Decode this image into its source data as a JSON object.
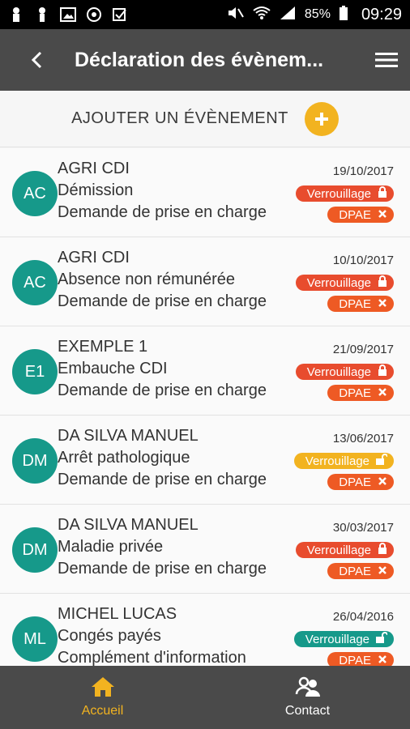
{
  "status_bar": {
    "battery": "85%",
    "time": "09:29"
  },
  "header": {
    "title": "Déclaration des évènem..."
  },
  "add_event": {
    "label": "AJOUTER UN ÉVÈNEMENT"
  },
  "colors": {
    "teal": "#16998a",
    "red": "#ee5a24",
    "orange_red": "#e84c2e",
    "yellow": "#f2b320",
    "dark_bar": "#4a4a4a"
  },
  "events": [
    {
      "initials": "AC",
      "name": "AGRI CDI",
      "type": "Démission",
      "detail": "Demande de prise en charge",
      "date": "19/10/2017",
      "lock_label": "Verrouillage",
      "lock_color": "#e84c2e",
      "lock_icon": "lock-closed-icon",
      "dpae_label": "DPAE"
    },
    {
      "initials": "AC",
      "name": "AGRI CDI",
      "type": "Absence non rémunérée",
      "detail": "Demande de prise en charge",
      "date": "10/10/2017",
      "lock_label": "Verrouillage",
      "lock_color": "#e84c2e",
      "lock_icon": "lock-closed-icon",
      "dpae_label": "DPAE"
    },
    {
      "initials": "E1",
      "name": "EXEMPLE 1",
      "type": "Embauche CDI",
      "detail": "Demande de prise en charge",
      "date": "21/09/2017",
      "lock_label": "Verrouillage",
      "lock_color": "#e84c2e",
      "lock_icon": "lock-closed-icon",
      "dpae_label": "DPAE"
    },
    {
      "initials": "DM",
      "name": "DA SILVA MANUEL",
      "type": "Arrêt pathologique",
      "detail": "Demande de prise en charge",
      "date": "13/06/2017",
      "lock_label": "Verrouillage",
      "lock_color": "#f2b320",
      "lock_icon": "lock-open-icon",
      "dpae_label": "DPAE"
    },
    {
      "initials": "DM",
      "name": "DA SILVA MANUEL",
      "type": "Maladie privée",
      "detail": "Demande de prise en charge",
      "date": "30/03/2017",
      "lock_label": "Verrouillage",
      "lock_color": "#e84c2e",
      "lock_icon": "lock-closed-icon",
      "dpae_label": "DPAE"
    },
    {
      "initials": "ML",
      "name": "MICHEL LUCAS",
      "type": "Congés payés",
      "detail": "Complément d'information",
      "date": "26/04/2016",
      "lock_label": "Verrouillage",
      "lock_color": "#16998a",
      "lock_icon": "lock-open-icon",
      "dpae_label": "DPAE"
    }
  ],
  "bottom_nav": [
    {
      "label": "Accueil",
      "icon": "home-icon",
      "color": "#f2b320"
    },
    {
      "label": "Contact",
      "icon": "contact-icon",
      "color": "#ffffff"
    }
  ]
}
